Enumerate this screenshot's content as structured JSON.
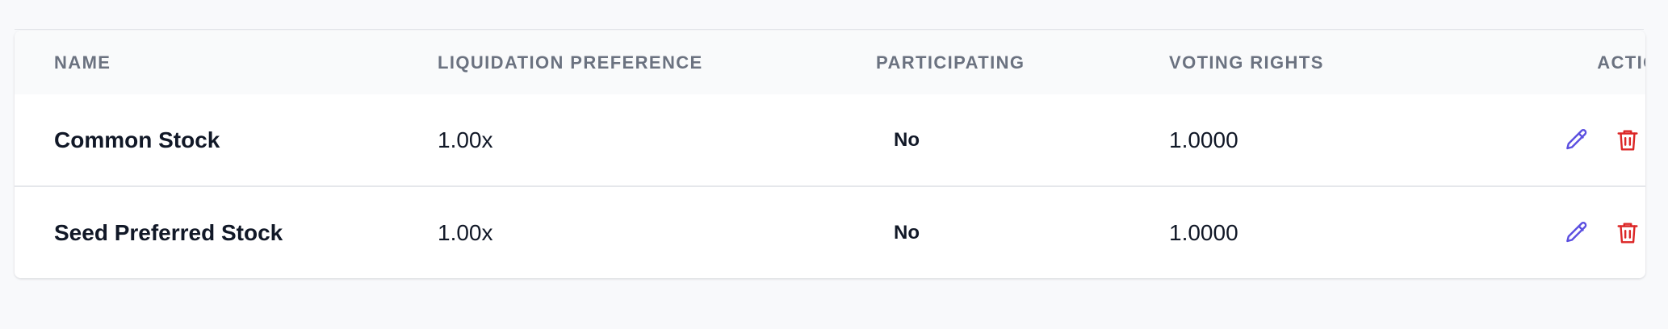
{
  "table": {
    "headers": {
      "name": "NAME",
      "liquidation_preference": "LIQUIDATION PREFERENCE",
      "participating": "PARTICIPATING",
      "voting_rights": "VOTING RIGHTS",
      "actions": "ACTIONS"
    },
    "rows": [
      {
        "name": "Common Stock",
        "liquidation_preference": "1.00x",
        "participating": "No",
        "voting_rights": "1.0000",
        "edit_icon": "pencil-icon",
        "delete_icon": "trash-icon"
      },
      {
        "name": "Seed Preferred Stock",
        "liquidation_preference": "1.00x",
        "participating": "No",
        "voting_rights": "1.0000",
        "edit_icon": "pencil-icon",
        "delete_icon": "trash-icon"
      }
    ]
  },
  "colors": {
    "edit_icon": "#5b4fe0",
    "delete_icon": "#dc2626",
    "header_text": "#6b7280",
    "body_text": "#111827"
  }
}
